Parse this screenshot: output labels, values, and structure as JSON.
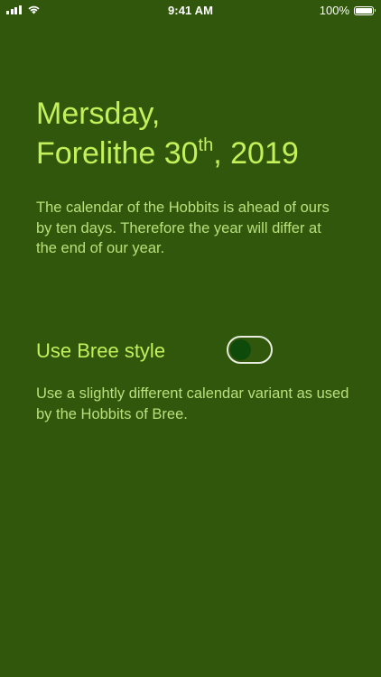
{
  "status_bar": {
    "time": "9:41 AM",
    "battery_percent": "100%",
    "signal_icon": "cellular-signal-icon",
    "wifi_icon": "wifi-icon",
    "battery_icon": "battery-icon"
  },
  "date": {
    "weekday": "Mersday,",
    "month_day": "Forelithe 30",
    "ordinal_suffix": "th",
    "year": ", 2019"
  },
  "description": "The calendar of the Hobbits is ahead of ours by ten days. Therefore the year will differ at the end of our year.",
  "bree_setting": {
    "label": "Use Bree style",
    "enabled": false,
    "description": "Use a slightly different calendar variant as used by the Hobbits of Bree."
  },
  "colors": {
    "background": "#30570c",
    "accent": "#c4f05a",
    "body_text": "#b9e07a",
    "toggle_knob": "#0e4a0a"
  }
}
